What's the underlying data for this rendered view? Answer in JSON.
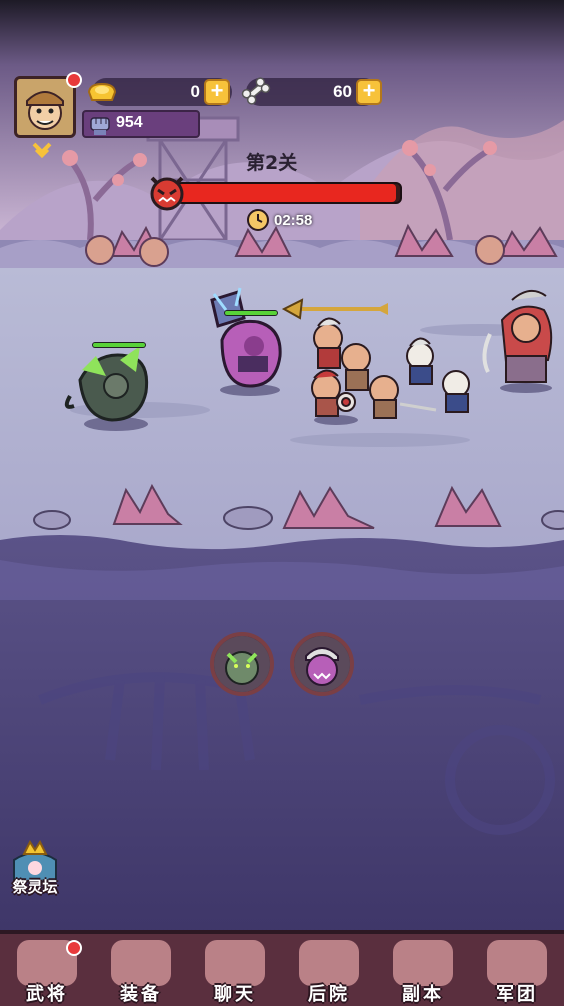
{
  "hud": {
    "gold_value": "0",
    "bone_value": "60",
    "power_value": "954",
    "colors": {
      "gold": "#f7c23a",
      "accent": "#6a3f7d"
    }
  },
  "stage": {
    "label": "第2关",
    "timer": "02:58",
    "boss_health_fraction": 0.98
  },
  "battle": {
    "ally_health_fractions": [
      1.0,
      1.0
    ]
  },
  "side": {
    "altar_label": "祭灵坛"
  },
  "nav": {
    "items": [
      {
        "label": "武将",
        "icon": "general-icon",
        "badge": true
      },
      {
        "label": "装备",
        "icon": "equipment-icon",
        "badge": false
      },
      {
        "label": "聊天",
        "icon": "chat-icon",
        "badge": false
      },
      {
        "label": "后院",
        "icon": "backyard-icon",
        "badge": false
      },
      {
        "label": "副本",
        "icon": "dungeon-icon",
        "badge": false
      },
      {
        "label": "军团",
        "icon": "legion-icon",
        "badge": false
      }
    ]
  }
}
